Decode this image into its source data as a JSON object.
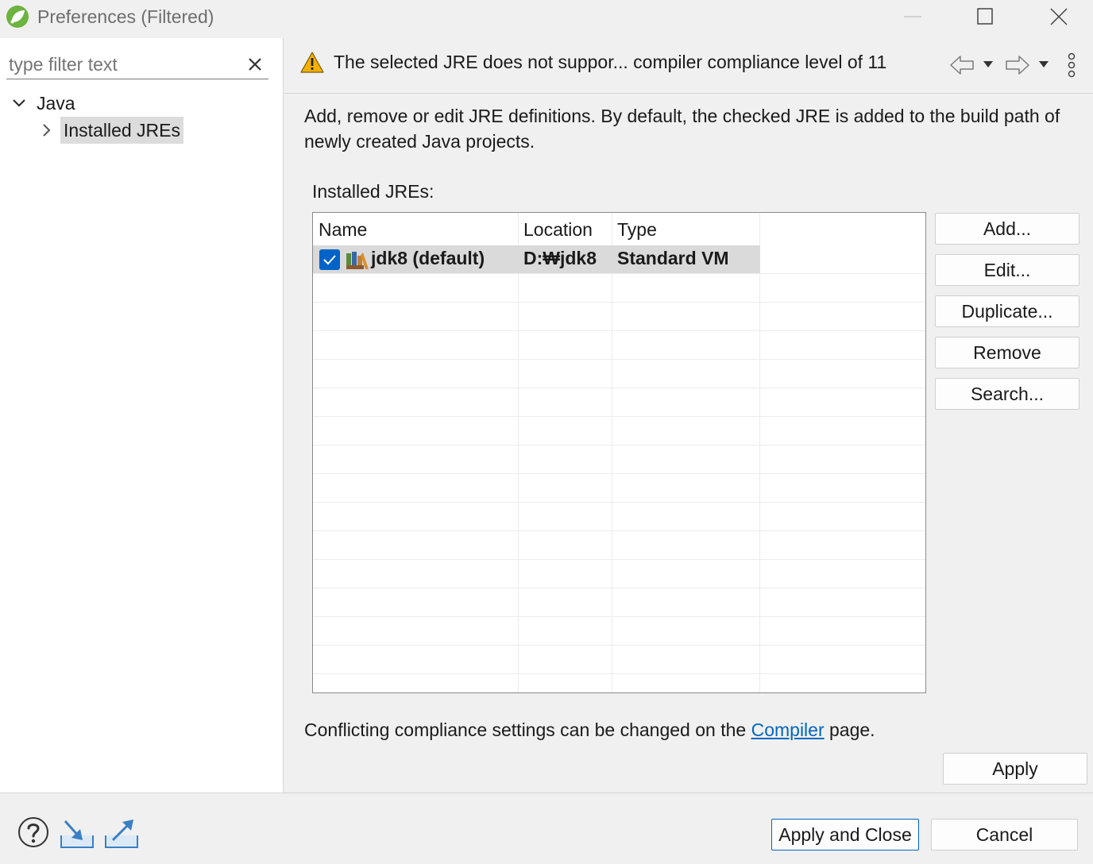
{
  "window": {
    "title": "Preferences (Filtered)"
  },
  "sidebar": {
    "filter_placeholder": "type filter text",
    "tree": [
      {
        "label": "Java",
        "expanded": true
      },
      {
        "label": "Installed JREs",
        "selected": true
      }
    ]
  },
  "header": {
    "warning_message": "The selected JRE does not suppor... compiler compliance level of 11"
  },
  "main": {
    "description": "Add, remove or edit JRE definitions. By default, the checked JRE is added to the build path of newly created Java projects.",
    "installed_label": "Installed JREs:",
    "table": {
      "columns": [
        "Name",
        "Location",
        "Type"
      ],
      "rows": [
        {
          "name": "jdk8 (default)",
          "location": "D:₩jdk8",
          "type": "Standard VM",
          "checked": true
        }
      ]
    },
    "buttons": {
      "add": "Add...",
      "edit": "Edit...",
      "duplicate": "Duplicate...",
      "remove": "Remove",
      "search": "Search..."
    },
    "conflict_prefix": "Conflicting compliance settings can be changed on the",
    "conflict_link": "Compiler",
    "conflict_suffix": "page.",
    "apply": "Apply"
  },
  "footer": {
    "apply_close": "Apply and Close",
    "cancel": "Cancel"
  },
  "colors": {
    "accent": "#0063c8",
    "link": "#0066bf",
    "selection": "#dadada",
    "warning": "#f5b000"
  },
  "icons": [
    "spring-app-icon",
    "minimize-icon",
    "maximize-icon",
    "close-icon",
    "clear-icon",
    "chevron-down-icon",
    "chevron-right-icon",
    "warning-icon",
    "back-arrow-icon",
    "forward-arrow-icon",
    "dropdown-icon",
    "view-menu-icon",
    "checkbox-icon",
    "jre-library-icon",
    "help-icon",
    "import-icon",
    "export-icon"
  ]
}
